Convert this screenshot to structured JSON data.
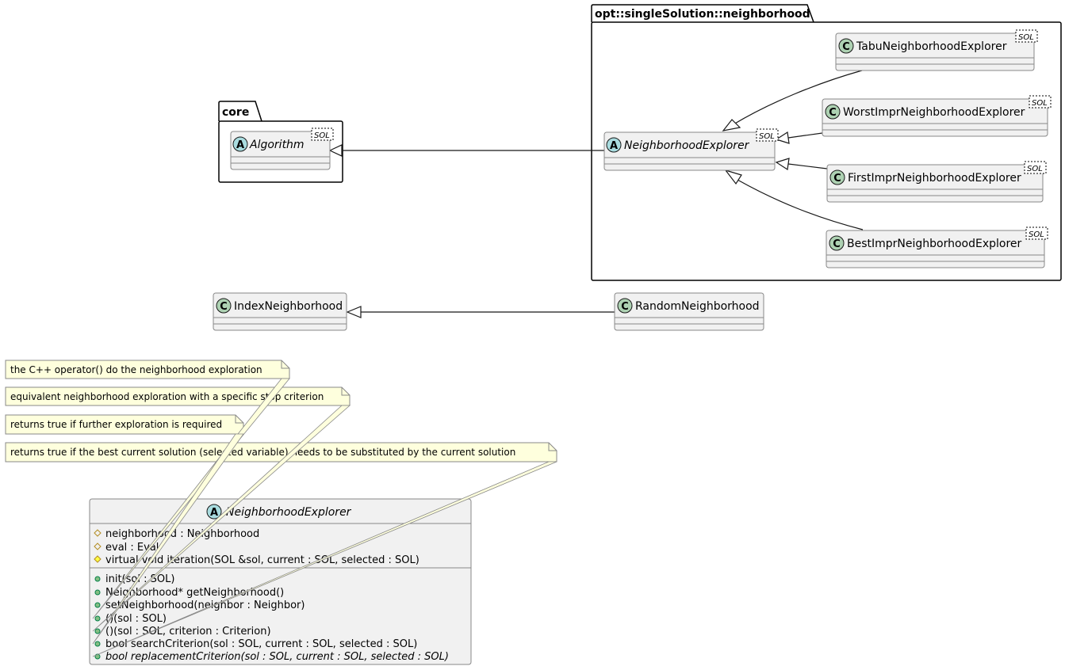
{
  "packages": {
    "core": {
      "name": "core"
    },
    "neighborhood": {
      "name": "opt::singleSolution::neighborhood"
    }
  },
  "classes": {
    "algorithm": {
      "name": "Algorithm",
      "kind": "abstract",
      "template": "SOL"
    },
    "neighborhood_explorer": {
      "name": "NeighborhoodExplorer",
      "kind": "abstract",
      "template": "SOL"
    },
    "tabu": {
      "name": "TabuNeighborhoodExplorer",
      "kind": "class",
      "template": "SOL"
    },
    "worst": {
      "name": "WorstImprNeighborhoodExplorer",
      "kind": "class",
      "template": "SOL"
    },
    "first": {
      "name": "FirstImprNeighborhoodExplorer",
      "kind": "class",
      "template": "SOL"
    },
    "best": {
      "name": "BestImprNeighborhoodExplorer",
      "kind": "class",
      "template": "SOL"
    },
    "index_neighborhood": {
      "name": "IndexNeighborhood",
      "kind": "class"
    },
    "random_neighborhood": {
      "name": "RandomNeighborhood",
      "kind": "class"
    }
  },
  "class_kind_letters": {
    "abstract": "A",
    "class": "C"
  },
  "colors": {
    "abstract_circle": "#A9DCDF",
    "class_circle": "#ADD1B2",
    "class_fill": "#F1F1F1",
    "class_border": "#888888",
    "note_fill": "#FEFFDD",
    "protected_icon": "#B38D22",
    "protected_icon_fill": "#FFFF44",
    "public_icon": "#038048",
    "public_icon_fill": "#84BE84"
  },
  "notes": [
    {
      "text": "the C++ operator() do the neighborhood exploration"
    },
    {
      "text": "equivalent neighborhood exploration with a specific stop criterion"
    },
    {
      "text": "returns true if further exploration is required"
    },
    {
      "text": "returns true if the best current solution (selected variable) needs to be substituted by the current solution"
    }
  ],
  "detail_class": {
    "name": "NeighborhoodExplorer",
    "kind": "abstract",
    "fields": [
      {
        "visibility": "protected",
        "text": "neighborhood : Neighborhood",
        "abstract": false
      },
      {
        "visibility": "protected",
        "text": "eval : Eval",
        "abstract": false
      },
      {
        "visibility": "protected-method",
        "text": "virtual void iteration(SOL &sol, current : SOL, selected : SOL)",
        "abstract": false
      }
    ],
    "methods": [
      {
        "visibility": "public",
        "text": "init(sol : SOL)",
        "abstract": false
      },
      {
        "visibility": "public",
        "text": "Neighborhood* getNeighborhood()",
        "abstract": false
      },
      {
        "visibility": "public",
        "text": "setNeighborhood(neighbor : Neighbor)",
        "abstract": false
      },
      {
        "visibility": "public",
        "text": "()(sol : SOL)",
        "abstract": false
      },
      {
        "visibility": "public",
        "text": "()(sol : SOL, criterion : Criterion)",
        "abstract": false
      },
      {
        "visibility": "public",
        "text": "bool searchCriterion(sol : SOL, current : SOL, selected : SOL)",
        "abstract": false
      },
      {
        "visibility": "public",
        "text": "bool replacementCriterion(sol : SOL, current : SOL, selected : SOL)",
        "abstract": true
      }
    ]
  },
  "relations": [
    {
      "type": "inheritance",
      "from": "neighborhood_explorer",
      "to": "algorithm"
    },
    {
      "type": "inheritance",
      "from": "tabu",
      "to": "neighborhood_explorer"
    },
    {
      "type": "inheritance",
      "from": "worst",
      "to": "neighborhood_explorer"
    },
    {
      "type": "inheritance",
      "from": "first",
      "to": "neighborhood_explorer"
    },
    {
      "type": "inheritance",
      "from": "best",
      "to": "neighborhood_explorer"
    },
    {
      "type": "inheritance",
      "from": "random_neighborhood",
      "to": "index_neighborhood"
    },
    {
      "type": "note-link",
      "from": "note-0",
      "to": "method-3"
    },
    {
      "type": "note-link",
      "from": "note-1",
      "to": "method-4"
    },
    {
      "type": "note-link",
      "from": "note-2",
      "to": "method-5"
    },
    {
      "type": "note-link",
      "from": "note-3",
      "to": "method-6"
    }
  ]
}
